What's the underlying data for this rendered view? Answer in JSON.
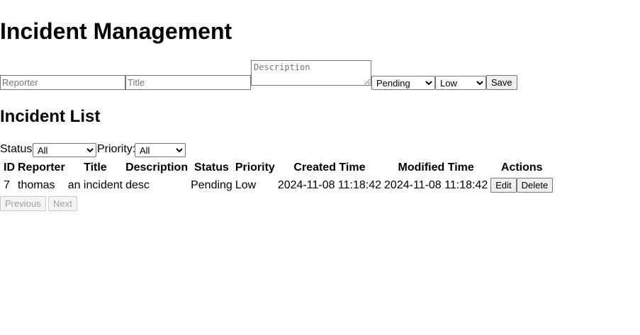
{
  "page": {
    "title": "Incident Management"
  },
  "form": {
    "reporter_placeholder": "Reporter",
    "title_placeholder": "Title",
    "description_placeholder": "Description",
    "status_selected": "Pending",
    "priority_selected": "Low",
    "save_label": "Save"
  },
  "list": {
    "heading": "Incident List",
    "filters": {
      "status_label": "Status:",
      "status_selected": "All",
      "priority_label": "Priority:",
      "priority_selected": "All"
    },
    "columns": [
      "ID",
      "Reporter",
      "Title",
      "Description",
      "Status",
      "Priority",
      "Created Time",
      "Modified Time",
      "Actions"
    ],
    "rows": [
      {
        "id": "7",
        "reporter": "thomas",
        "title": "an incident",
        "description": "desc",
        "status": "Pending",
        "priority": "Low",
        "created": "2024-11-08 11:18:42",
        "modified": "2024-11-08 11:18:42",
        "edit_label": "Edit",
        "delete_label": "Delete"
      }
    ]
  },
  "pagination": {
    "previous_label": "Previous",
    "next_label": "Next"
  }
}
